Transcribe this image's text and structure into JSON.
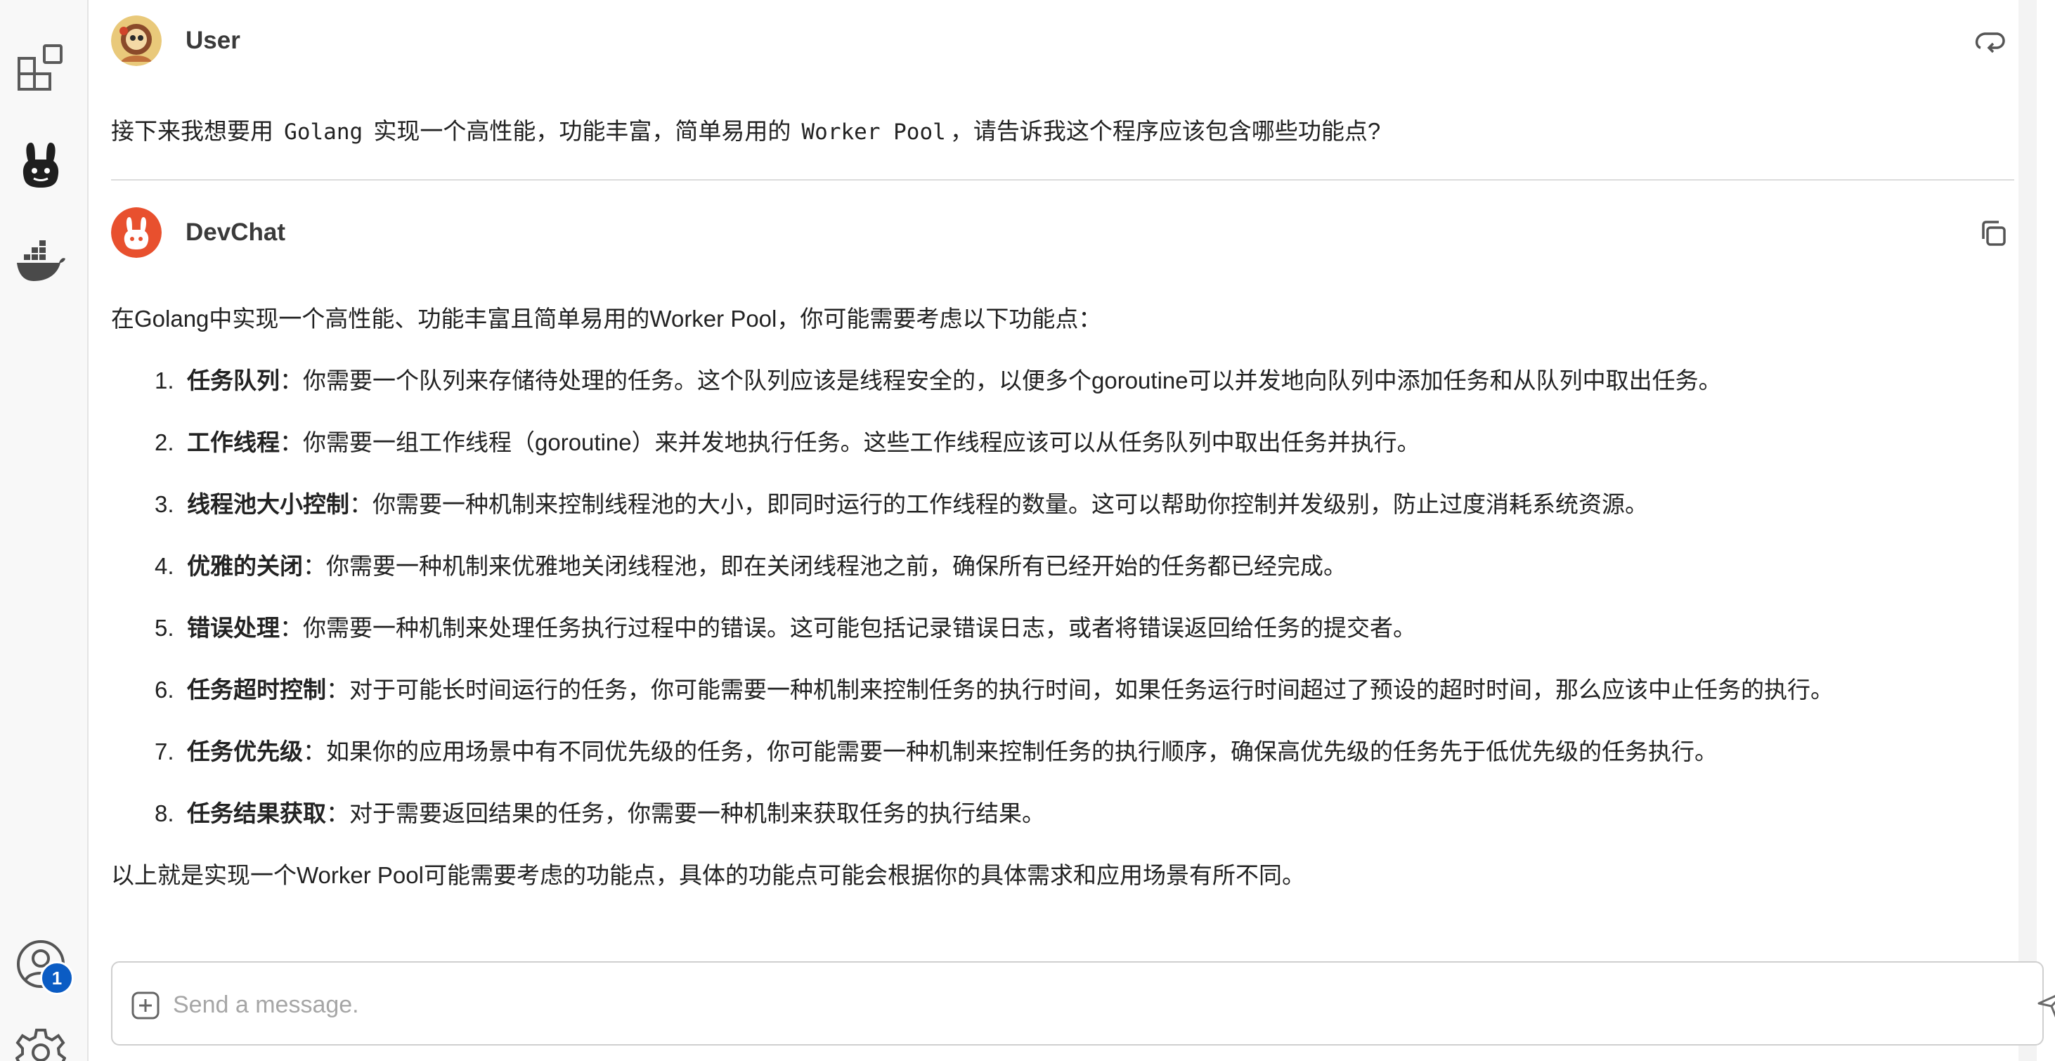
{
  "sidebar": {
    "icons": [
      "extensions-icon",
      "devchat-bunny-icon",
      "docker-whale-icon",
      "accounts-icon",
      "settings-gear-icon"
    ],
    "accounts_badge": "1"
  },
  "user_message": {
    "sender": "User",
    "text_parts": [
      "接下来我想要用",
      "Golang",
      "实现一个高性能，功能丰富，简单易用的",
      "Worker Pool",
      "，请告诉我这个程序应该包含哪些功能点?"
    ]
  },
  "bot_message": {
    "sender": "DevChat",
    "intro": "在Golang中实现一个高性能、功能丰富且简单易用的Worker Pool，你可能需要考虑以下功能点：",
    "features": [
      {
        "num": "1.",
        "title": "任务队列",
        "desc": "：你需要一个队列来存储待处理的任务。这个队列应该是线程安全的，以便多个goroutine可以并发地向队列中添加任务和从队列中取出任务。"
      },
      {
        "num": "2.",
        "title": "工作线程",
        "desc": "：你需要一组工作线程（goroutine）来并发地执行任务。这些工作线程应该可以从任务队列中取出任务并执行。"
      },
      {
        "num": "3.",
        "title": "线程池大小控制",
        "desc": "：你需要一种机制来控制线程池的大小，即同时运行的工作线程的数量。这可以帮助你控制并发级别，防止过度消耗系统资源。"
      },
      {
        "num": "4.",
        "title": "优雅的关闭",
        "desc": "：你需要一种机制来优雅地关闭线程池，即在关闭线程池之前，确保所有已经开始的任务都已经完成。"
      },
      {
        "num": "5.",
        "title": "错误处理",
        "desc": "：你需要一种机制来处理任务执行过程中的错误。这可能包括记录错误日志，或者将错误返回给任务的提交者。"
      },
      {
        "num": "6.",
        "title": "任务超时控制",
        "desc": "：对于可能长时间运行的任务，你可能需要一种机制来控制任务的执行时间，如果任务运行时间超过了预设的超时时间，那么应该中止任务的执行。"
      },
      {
        "num": "7.",
        "title": "任务优先级",
        "desc": "：如果你的应用场景中有不同优先级的任务，你可能需要一种机制来控制任务的执行顺序，确保高优先级的任务先于低优先级的任务执行。"
      },
      {
        "num": "8.",
        "title": "任务结果获取",
        "desc": "：对于需要返回结果的任务，你需要一种机制来获取任务的执行结果。"
      }
    ],
    "conclusion": "以上就是实现一个Worker Pool可能需要考虑的功能点，具体的功能点可能会根据你的具体需求和应用场景有所不同。"
  },
  "input": {
    "placeholder": "Send a message.",
    "value": ""
  },
  "colors": {
    "devchat_brand": "#e8502e",
    "badge": "#0b5cc4",
    "sidebar_bg": "#f8f8f8"
  }
}
